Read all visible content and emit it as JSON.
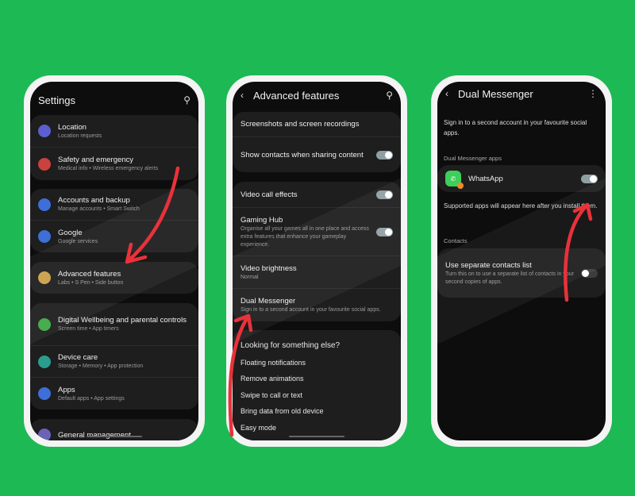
{
  "colors": {
    "background": "#1db954",
    "arrow": "#e8323a",
    "toggle_on": "#8fa0a3"
  },
  "settings": {
    "title": "Settings",
    "search_icon": "search-icon",
    "groups": [
      [
        {
          "title": "Location",
          "sub": "Location requests",
          "color": "#5b5fd0",
          "icon": "location-pin-icon"
        },
        {
          "title": "Safety and emergency",
          "sub": "Medical info  •  Wireless emergency alerts",
          "color": "#c9423e",
          "icon": "alert-icon"
        }
      ],
      [
        {
          "title": "Accounts and backup",
          "sub": "Manage accounts  •  Smart Switch",
          "color": "#3e6fd8",
          "icon": "sync-icon"
        },
        {
          "title": "Google",
          "sub": "Google services",
          "color": "#3e6fd8",
          "icon": "google-icon"
        }
      ],
      [
        {
          "title": "Advanced features",
          "sub": "Labs  •  S Pen  •  Side button",
          "color": "#c9a04a",
          "icon": "gear-icon"
        }
      ],
      [
        {
          "title": "Digital Wellbeing and parental controls",
          "sub": "Screen time  •  App timers",
          "color": "#3fa846",
          "icon": "wellbeing-icon"
        },
        {
          "title": "Device care",
          "sub": "Storage  •  Memory  •  App protection",
          "color": "#2a9d8f",
          "icon": "device-care-icon"
        },
        {
          "title": "Apps",
          "sub": "Default apps  •  App settings",
          "color": "#3e6fd8",
          "icon": "apps-grid-icon"
        }
      ],
      [
        {
          "title": "General management",
          "sub": "",
          "color": "#6a63b8",
          "icon": "sliders-icon"
        }
      ]
    ]
  },
  "advanced": {
    "title": "Advanced features",
    "group1": [
      {
        "title": "Screenshots and screen recordings",
        "sub": ""
      },
      {
        "title": "Show contacts when sharing content",
        "sub": "",
        "toggle": true
      }
    ],
    "group2": [
      {
        "title": "Video call effects",
        "sub": "",
        "toggle": true
      },
      {
        "title": "Gaming Hub",
        "sub": "Organise all your games all in one place and access extra features that enhance your gameplay experience.",
        "toggle": true
      },
      {
        "title": "Video brightness",
        "sub": "Normal"
      },
      {
        "title": "Dual Messenger",
        "sub": "Sign in to a second account in your favourite social apps."
      }
    ],
    "looking": {
      "heading": "Looking for something else?",
      "items": [
        "Floating notifications",
        "Remove animations",
        "Swipe to call or text",
        "Bring data from old device",
        "Easy mode"
      ]
    }
  },
  "dual": {
    "title": "Dual Messenger",
    "intro": "Sign in to a second account in your favourite social apps.",
    "apps_label": "Dual Messenger apps",
    "app": {
      "name": "WhatsApp",
      "enabled": true
    },
    "supported": "Supported apps will appear here after you install them.",
    "contacts_label": "Contacts",
    "contacts": {
      "title": "Use separate contacts list",
      "sub": "Turn this on to use a separate list of contacts in your second copies of apps.",
      "enabled": false
    }
  }
}
